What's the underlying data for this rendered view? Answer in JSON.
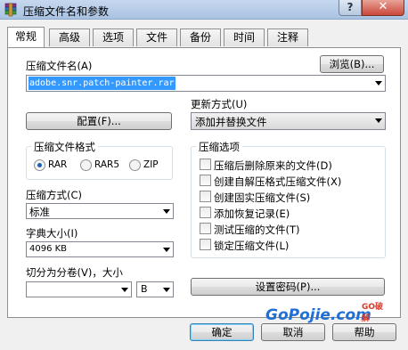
{
  "window": {
    "title": "压缩文件名和参数",
    "help_label": "?",
    "close_label": "✕"
  },
  "tabs": [
    {
      "label": "常规",
      "active": true
    },
    {
      "label": "高级",
      "active": false
    },
    {
      "label": "选项",
      "active": false
    },
    {
      "label": "文件",
      "active": false
    },
    {
      "label": "备份",
      "active": false
    },
    {
      "label": "时间",
      "active": false
    },
    {
      "label": "注释",
      "active": false
    }
  ],
  "general": {
    "archive_name_label": "压缩文件名(A)",
    "browse_label": "浏览(B)...",
    "archive_name_value": "adobe.snr.patch-painter.rar",
    "update_mode_label": "更新方式(U)",
    "update_mode_value": "添加并替换文件",
    "profiles_label": "配置(F)...",
    "format_group_title": "压缩文件格式",
    "formats": [
      {
        "label": "RAR",
        "selected": true
      },
      {
        "label": "RAR5",
        "selected": false
      },
      {
        "label": "ZIP",
        "selected": false
      }
    ],
    "method_label": "压缩方式(C)",
    "method_value": "标准",
    "dictionary_label": "字典大小(I)",
    "dictionary_value": "4096 KB",
    "split_label": "切分为分卷(V)，大小",
    "split_value": "",
    "split_unit": "B",
    "options_group_title": "压缩选项",
    "options": [
      {
        "label": "压缩后删除原来的文件(D)",
        "checked": false
      },
      {
        "label": "创建自解压格式压缩文件(X)",
        "checked": false
      },
      {
        "label": "创建固实压缩文件(S)",
        "checked": false
      },
      {
        "label": "添加恢复记录(E)",
        "checked": false
      },
      {
        "label": "测试压缩的文件(T)",
        "checked": false
      },
      {
        "label": "锁定压缩文件(L)",
        "checked": false
      }
    ],
    "set_password_label": "设置密码(P)..."
  },
  "footer": {
    "ok_label": "确定",
    "cancel_label": "取消",
    "help_label": "帮助"
  },
  "watermark": {
    "brand": "GoPojie.com",
    "tag": "GO破解"
  },
  "colors": {
    "selection_highlight": "#3399ff",
    "titlebar": "#b9cfe9",
    "close_button": "#c9473a",
    "watermark_blue": "#1f6fd6",
    "watermark_red": "#d63a2a"
  }
}
